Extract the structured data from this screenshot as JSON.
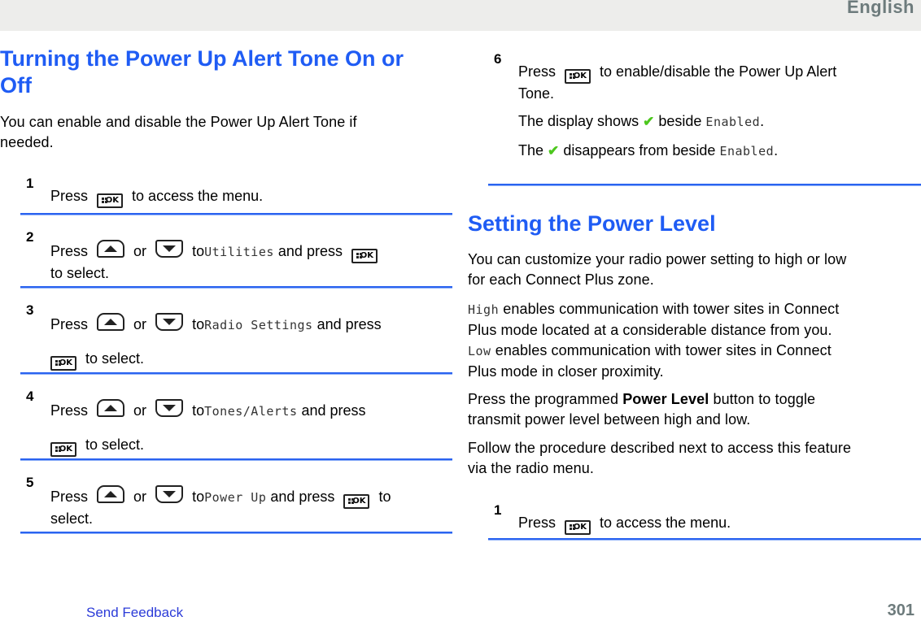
{
  "header": {
    "language": "English"
  },
  "left_section": {
    "title_line1": "Turning the Power Up Alert Tone On or",
    "title_line2": "Off",
    "intro_line1": "You can enable and disable the Power Up Alert Tone if",
    "intro_line2": "needed.",
    "steps": [
      {
        "num": "1",
        "press": "Press",
        "rest": "to access the menu."
      },
      {
        "num": "2",
        "press": "Press",
        "or": "or",
        "to": "to",
        "target": "Utilities",
        "and_press": "and press",
        "cont": "to select."
      },
      {
        "num": "3",
        "press": "Press",
        "or": "or",
        "to": "to",
        "target": "Radio Settings",
        "and_press": "and press",
        "cont": "to select."
      },
      {
        "num": "4",
        "press": "Press",
        "or": "or",
        "to": "to",
        "target": "Tones/Alerts",
        "and_press": "and press",
        "cont": "to select."
      },
      {
        "num": "5",
        "press": "Press",
        "or": "or",
        "to": "to",
        "target": "Power Up",
        "and_press": "and press",
        "tail": "to",
        "cont": "select."
      }
    ]
  },
  "right_section": {
    "step6": {
      "num": "6",
      "press": "Press",
      "rest_line1": "to enable/disable the Power Up Alert",
      "rest_line2": "Tone.",
      "result1_pre": "The display shows",
      "result1_mid": "beside",
      "result1_target": "Enabled",
      "result2_pre": "The",
      "result2_mid": "disappears from beside",
      "result2_target": "Enabled",
      "period": "."
    },
    "title": "Setting the Power Level",
    "para1_line1": "You can customize your radio power setting to high or low",
    "para1_line2": "for each Connect Plus zone.",
    "high_label": "High",
    "high_line1": "enables communication with tower sites in Connect",
    "high_line2": "Plus mode located at a considerable distance from you.",
    "low_label": "Low",
    "low_line1": "enables communication with tower sites in Connect",
    "low_line2": "Plus mode in closer proximity.",
    "para3_pre": "Press the programmed",
    "para3_bold": "Power Level",
    "para3_post": "button to toggle",
    "para3_line2": "transmit power level between high and low.",
    "para4_line1": "Follow the procedure described next to access this feature",
    "para4_line2": "via the radio menu.",
    "step1": {
      "num": "1",
      "press": "Press",
      "rest": "to access the menu."
    }
  },
  "icons": {
    "ok_label": "OK",
    "check": "✔"
  },
  "footer": {
    "feedback_link": "Send Feedback",
    "page_number": "301"
  },
  "colors": {
    "heading": "#1f5cf4",
    "rule": "#2a63f0",
    "check": "#4cc71d",
    "link": "#2b3bd8",
    "muted": "#6d7b7c"
  }
}
